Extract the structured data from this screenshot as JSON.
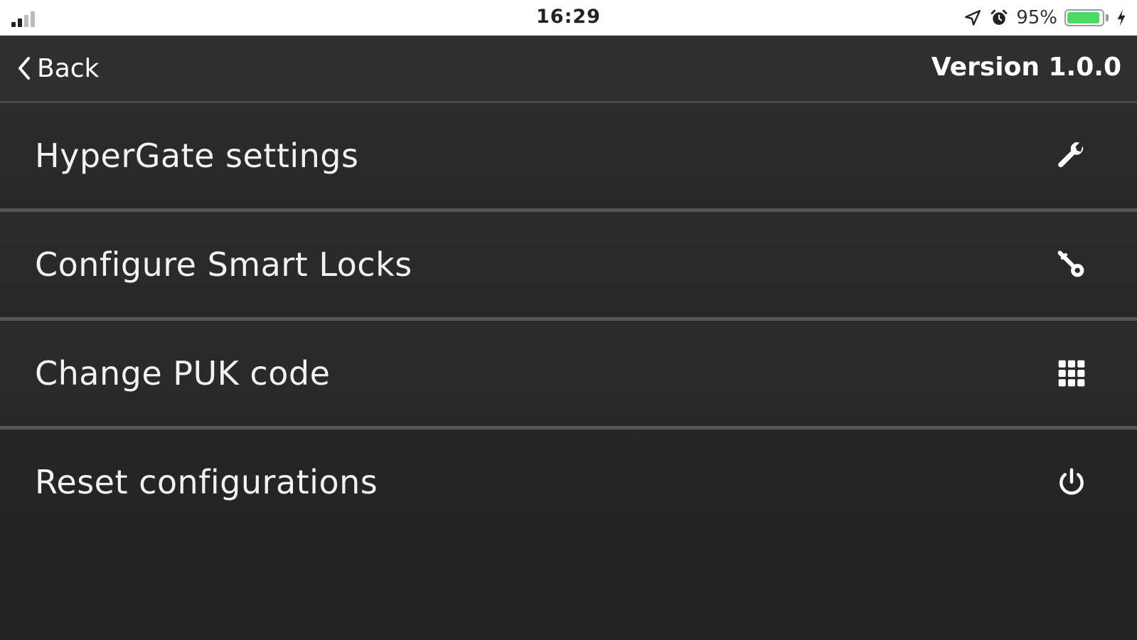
{
  "status_bar": {
    "time": "16:29",
    "battery_percent": "95%",
    "battery_level": 0.95,
    "signal_bars_active": 2,
    "signal_bars_total": 4,
    "icons": [
      "signal-icon",
      "location-arrow-icon",
      "alarm-clock-icon",
      "battery-icon",
      "charging-bolt-icon"
    ],
    "colors": {
      "battery_fill": "#4cd964"
    }
  },
  "nav": {
    "back_label": "Back",
    "version": "Version 1.0.0"
  },
  "menu": {
    "items": [
      {
        "label": "HyperGate settings",
        "icon": "wrench-icon"
      },
      {
        "label": "Configure Smart Locks",
        "icon": "key-icon"
      },
      {
        "label": "Change PUK code",
        "icon": "keypad-grid-icon"
      },
      {
        "label": "Reset configurations",
        "icon": "power-icon"
      }
    ]
  }
}
